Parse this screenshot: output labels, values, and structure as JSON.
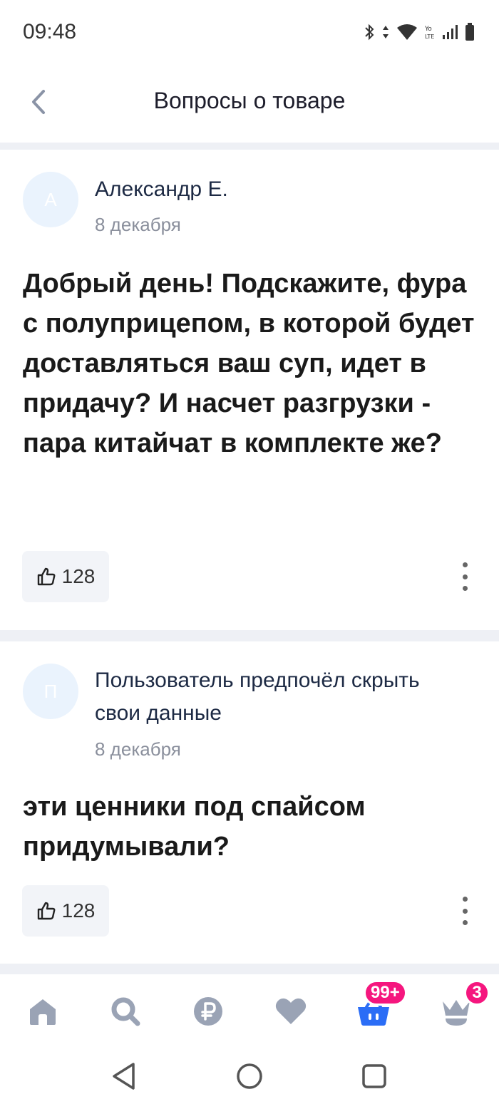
{
  "status_bar": {
    "time": "09:48",
    "icons": [
      "bluetooth-icon",
      "data-arrows-icon",
      "wifi-icon",
      "volte-icon",
      "signal-icon",
      "battery-icon"
    ]
  },
  "header": {
    "title": "Вопросы о товаре",
    "back_icon": "chevron-left-icon"
  },
  "questions": [
    {
      "avatar_letter": "А",
      "author": "Александр Е.",
      "date": "8 декабря",
      "text": "Добрый день! Подскажите, фура с полуприцепом, в которой будет доставляться ваш суп, идет в придачу? И насчет разгрузки - пара китайчат в комплекте же?",
      "likes": "128"
    },
    {
      "avatar_letter": "П",
      "author": "Пользователь предпочёл скрыть свои данные",
      "date": "8 декабря",
      "text": "эти ценники под спайсом придумывали?",
      "likes": "128"
    }
  ],
  "bottom_nav": {
    "items": [
      "home-icon",
      "search-icon",
      "ruble-icon",
      "heart-icon",
      "basket-icon",
      "profile-crown-icon"
    ],
    "basket_badge": "99+",
    "profile_badge": "3",
    "active_color": "#2b6df6",
    "inactive_color": "#9aa3b5",
    "badge_color": "#f5167e"
  },
  "system_nav": {
    "items": [
      "back-triangle-icon",
      "home-circle-icon",
      "recents-square-icon"
    ]
  }
}
